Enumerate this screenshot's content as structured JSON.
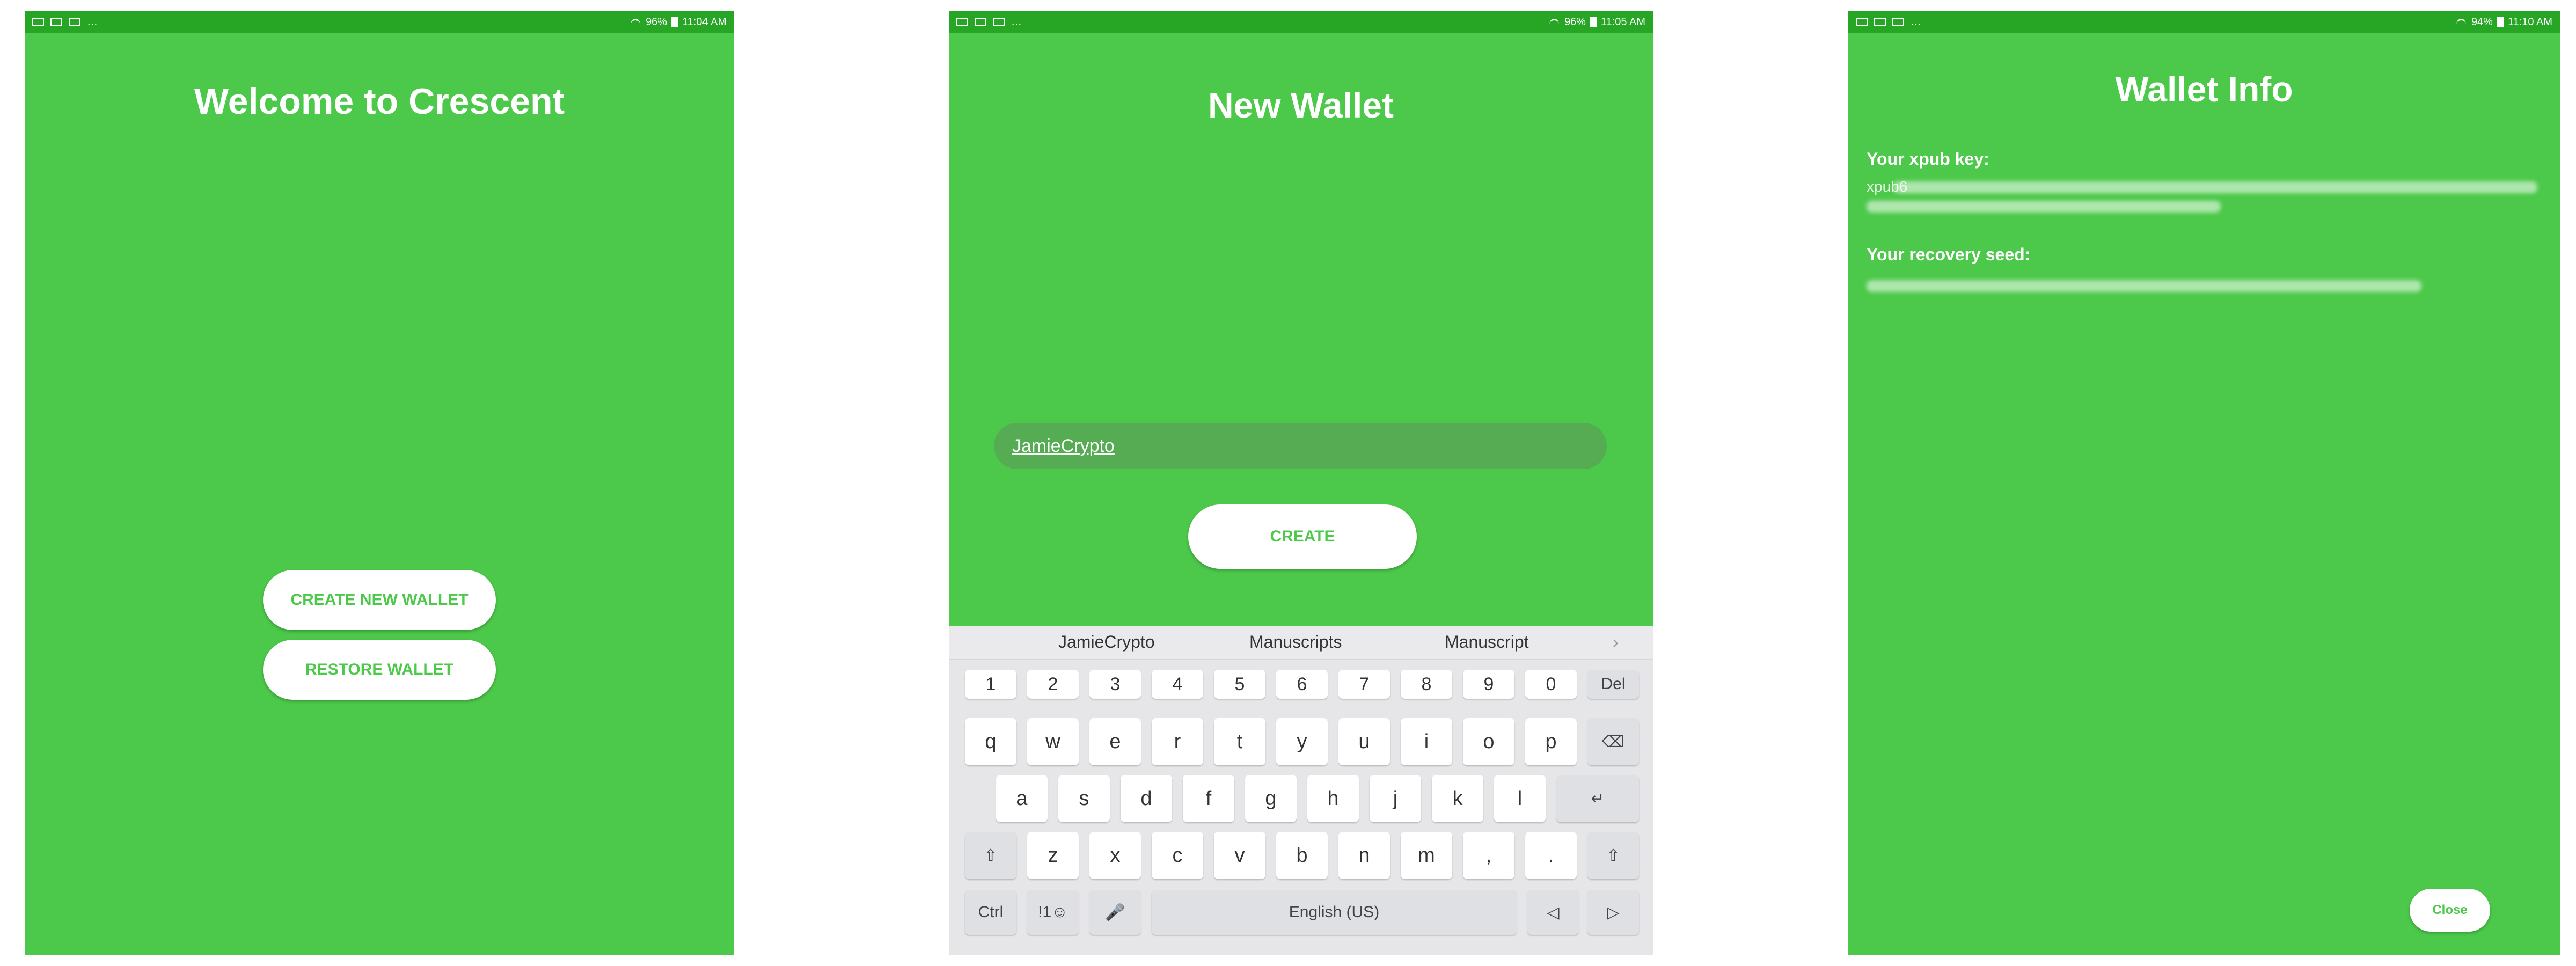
{
  "screens": {
    "welcome": {
      "status": {
        "battery": "96%",
        "time": "11:04 AM"
      },
      "title": "Welcome to Crescent",
      "create_button": "CREATE NEW WALLET",
      "restore_button": "RESTORE WALLET"
    },
    "new_wallet": {
      "status": {
        "battery": "96%",
        "time": "11:05 AM"
      },
      "title": "New Wallet",
      "name_value": "JamieCrypto",
      "create_button": "CREATE",
      "keyboard": {
        "suggestions": [
          "JamieCrypto",
          "Manuscripts",
          "Manuscript"
        ],
        "number_row": [
          "1",
          "2",
          "3",
          "4",
          "5",
          "6",
          "7",
          "8",
          "9",
          "0"
        ],
        "del": "Del",
        "row1": [
          "q",
          "w",
          "e",
          "r",
          "t",
          "y",
          "u",
          "i",
          "o",
          "p"
        ],
        "row2": [
          "a",
          "s",
          "d",
          "f",
          "g",
          "h",
          "j",
          "k",
          "l"
        ],
        "row3": [
          "z",
          "x",
          "c",
          "v",
          "b",
          "n",
          "m",
          ",",
          "."
        ],
        "ctrl": "Ctrl",
        "symbols": "!1☺",
        "space": "English (US)"
      }
    },
    "wallet_info": {
      "status": {
        "battery": "94%",
        "time": "11:10 AM"
      },
      "title": "Wallet Info",
      "xpub_label": "Your xpub key:",
      "xpub_value": "xpub6",
      "seed_label": "Your recovery seed:",
      "close_button": "Close"
    }
  },
  "colors": {
    "background": "#4cc94a",
    "statusbar": "#27a626",
    "accent_text": "#4cc94a"
  }
}
